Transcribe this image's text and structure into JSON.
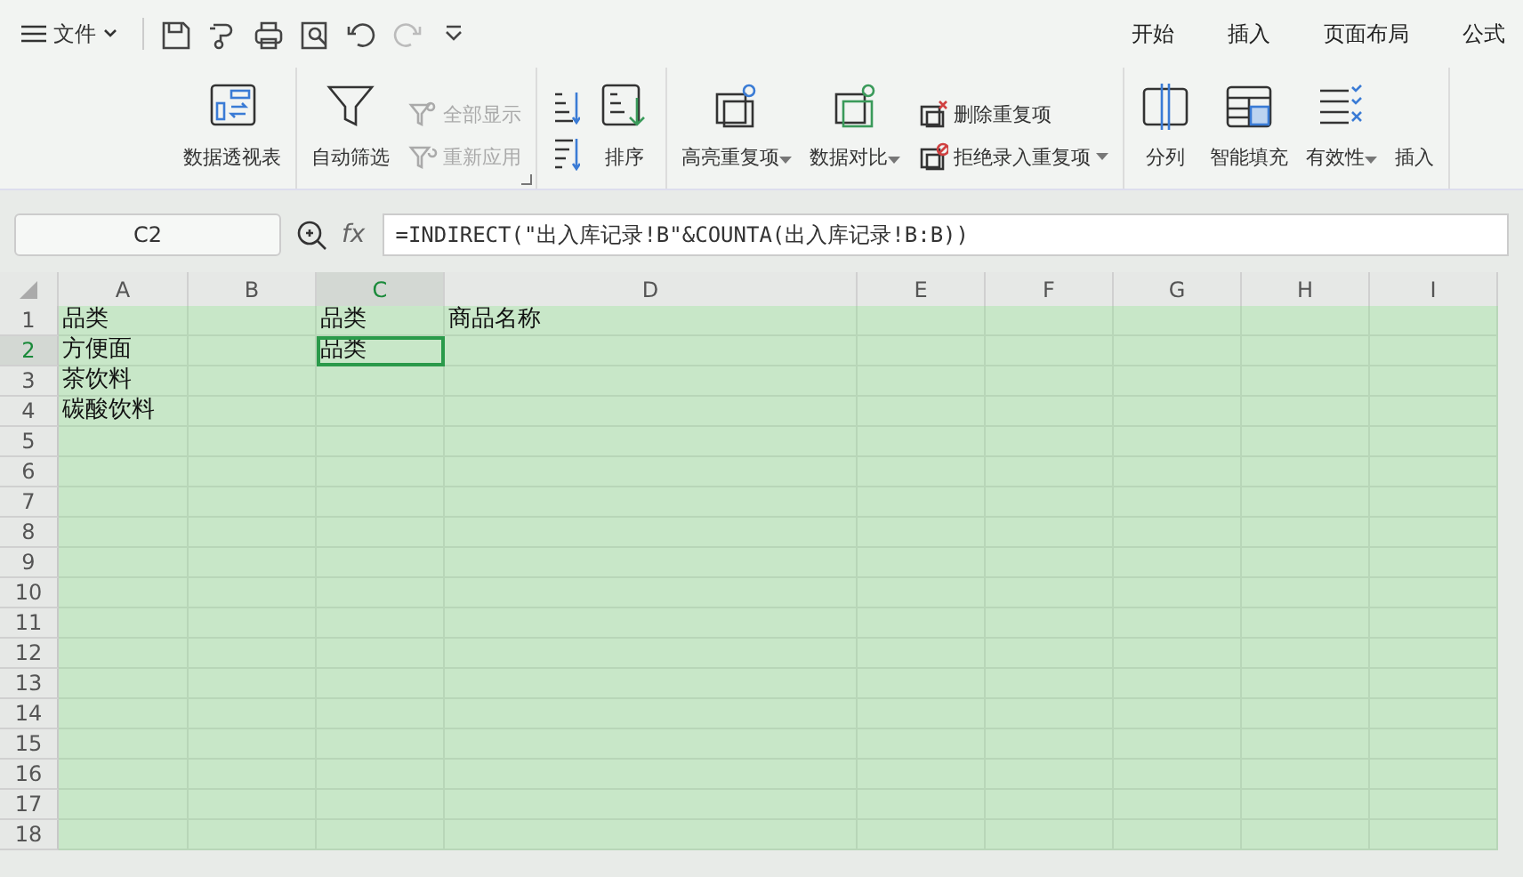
{
  "menu": {
    "label": "文件"
  },
  "quick_tools": [
    {
      "disabled": false
    },
    {
      "disabled": false
    },
    {
      "disabled": false
    },
    {
      "disabled": false
    },
    {
      "disabled": false
    },
    {
      "disabled": true
    },
    {
      "disabled": false
    }
  ],
  "tabs": [
    {
      "label": "开始",
      "selected": false
    },
    {
      "label": "插入",
      "selected": false
    },
    {
      "label": "页面布局",
      "selected": false
    },
    {
      "label": "公式",
      "selected": false
    }
  ],
  "ribbon_groups": [
    {
      "items": [
        {
          "kind": "large",
          "label": "数据透视表",
          "dropdown": false
        }
      ]
    },
    {
      "launcher": true,
      "items": [
        {
          "kind": "large",
          "label": "自动筛选",
          "dropdown": false
        },
        {
          "kind": "stack",
          "entries": [
            {
              "label": "全部显示",
              "disabled": true,
              "dropdown": false
            },
            {
              "label": "重新应用",
              "disabled": true,
              "dropdown": false
            }
          ]
        }
      ]
    },
    {
      "items": [
        {
          "kind": "sort-stack"
        },
        {
          "kind": "large",
          "label": "排序",
          "dropdown": false
        }
      ]
    },
    {
      "items": [
        {
          "kind": "large",
          "label": "高亮重复项",
          "dropdown": true
        },
        {
          "kind": "large",
          "label": "数据对比",
          "dropdown": true
        },
        {
          "kind": "stack",
          "entries": [
            {
              "label": "删除重复项",
              "disabled": false,
              "dropdown": false
            },
            {
              "label": "拒绝录入重复项",
              "disabled": false,
              "dropdown": true
            }
          ]
        }
      ]
    },
    {
      "items": [
        {
          "kind": "large",
          "label": "分列",
          "dropdown": false
        },
        {
          "kind": "large",
          "label": "智能填充",
          "dropdown": false
        },
        {
          "kind": "large",
          "label": "有效性",
          "dropdown": true
        },
        {
          "kind": "label-only",
          "label": "插入",
          "dropdown": false
        }
      ]
    }
  ],
  "formula_bar": {
    "name_box": "C2",
    "fx": "fx",
    "formula": "=INDIRECT(\"出入库记录!B\"&COUNTA(出入库记录!B:B))"
  },
  "sheet": {
    "columns": [
      {
        "label": "A",
        "selected": false
      },
      {
        "label": "B",
        "selected": false
      },
      {
        "label": "C",
        "selected": true
      },
      {
        "label": "D",
        "selected": false
      },
      {
        "label": "E",
        "selected": false
      },
      {
        "label": "F",
        "selected": false
      },
      {
        "label": "G",
        "selected": false
      },
      {
        "label": "H",
        "selected": false
      },
      {
        "label": "I",
        "selected": false
      }
    ],
    "rows": [
      {
        "label": "1",
        "selected": false,
        "cells": [
          "品类",
          null,
          "品类",
          "商品名称"
        ]
      },
      {
        "label": "2",
        "selected": true,
        "cells": [
          "方便面",
          null,
          "品类"
        ]
      },
      {
        "label": "3",
        "selected": false,
        "cells": [
          "茶饮料"
        ]
      },
      {
        "label": "4",
        "selected": false,
        "cells": [
          "碳酸饮料"
        ]
      },
      {
        "label": "5",
        "selected": false
      },
      {
        "label": "6",
        "selected": false
      },
      {
        "label": "7",
        "selected": false
      },
      {
        "label": "8",
        "selected": false
      },
      {
        "label": "9",
        "selected": false
      },
      {
        "label": "10",
        "selected": false
      },
      {
        "label": "11",
        "selected": false
      },
      {
        "label": "12",
        "selected": false
      },
      {
        "label": "13",
        "selected": false
      },
      {
        "label": "14",
        "selected": false
      },
      {
        "label": "15",
        "selected": false
      },
      {
        "label": "16",
        "selected": false
      },
      {
        "label": "17",
        "selected": false
      },
      {
        "label": "18",
        "selected": false
      }
    ]
  }
}
